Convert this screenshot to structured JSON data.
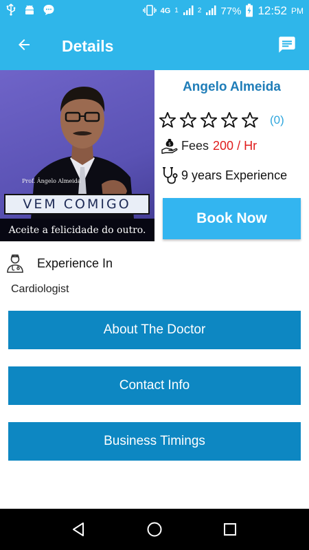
{
  "status_bar": {
    "network_type": "4G",
    "sim1": "1",
    "sim2": "2",
    "battery": "77%",
    "time": "12:52",
    "ampm": "PM"
  },
  "app_bar": {
    "title": "Details",
    "back_icon": "arrow-back-icon",
    "message_icon": "chat-message-icon"
  },
  "profile": {
    "photo_small_caption": "Prof. Ângelo Almeida",
    "photo_banner": "VEM COMIGO",
    "photo_bottom_text": "Aceite a felicidade do outro.",
    "name": "Angelo Almeida",
    "rating_count": "(0)",
    "fees_label": "Fees",
    "fees_amount": "200 / Hr",
    "experience": "9 years Experience",
    "book_label": "Book Now"
  },
  "experience_section": {
    "label": "Experience In",
    "specialty": "Cardiologist"
  },
  "sections": {
    "about": "About The Doctor",
    "contact": "Contact Info",
    "timings": "Business Timings"
  },
  "colors": {
    "primary": "#2fb6ea",
    "section_button": "#0d87c2",
    "book_button": "#33b5f0",
    "name": "#1f7db8",
    "fee_amount": "#e01b1b"
  }
}
